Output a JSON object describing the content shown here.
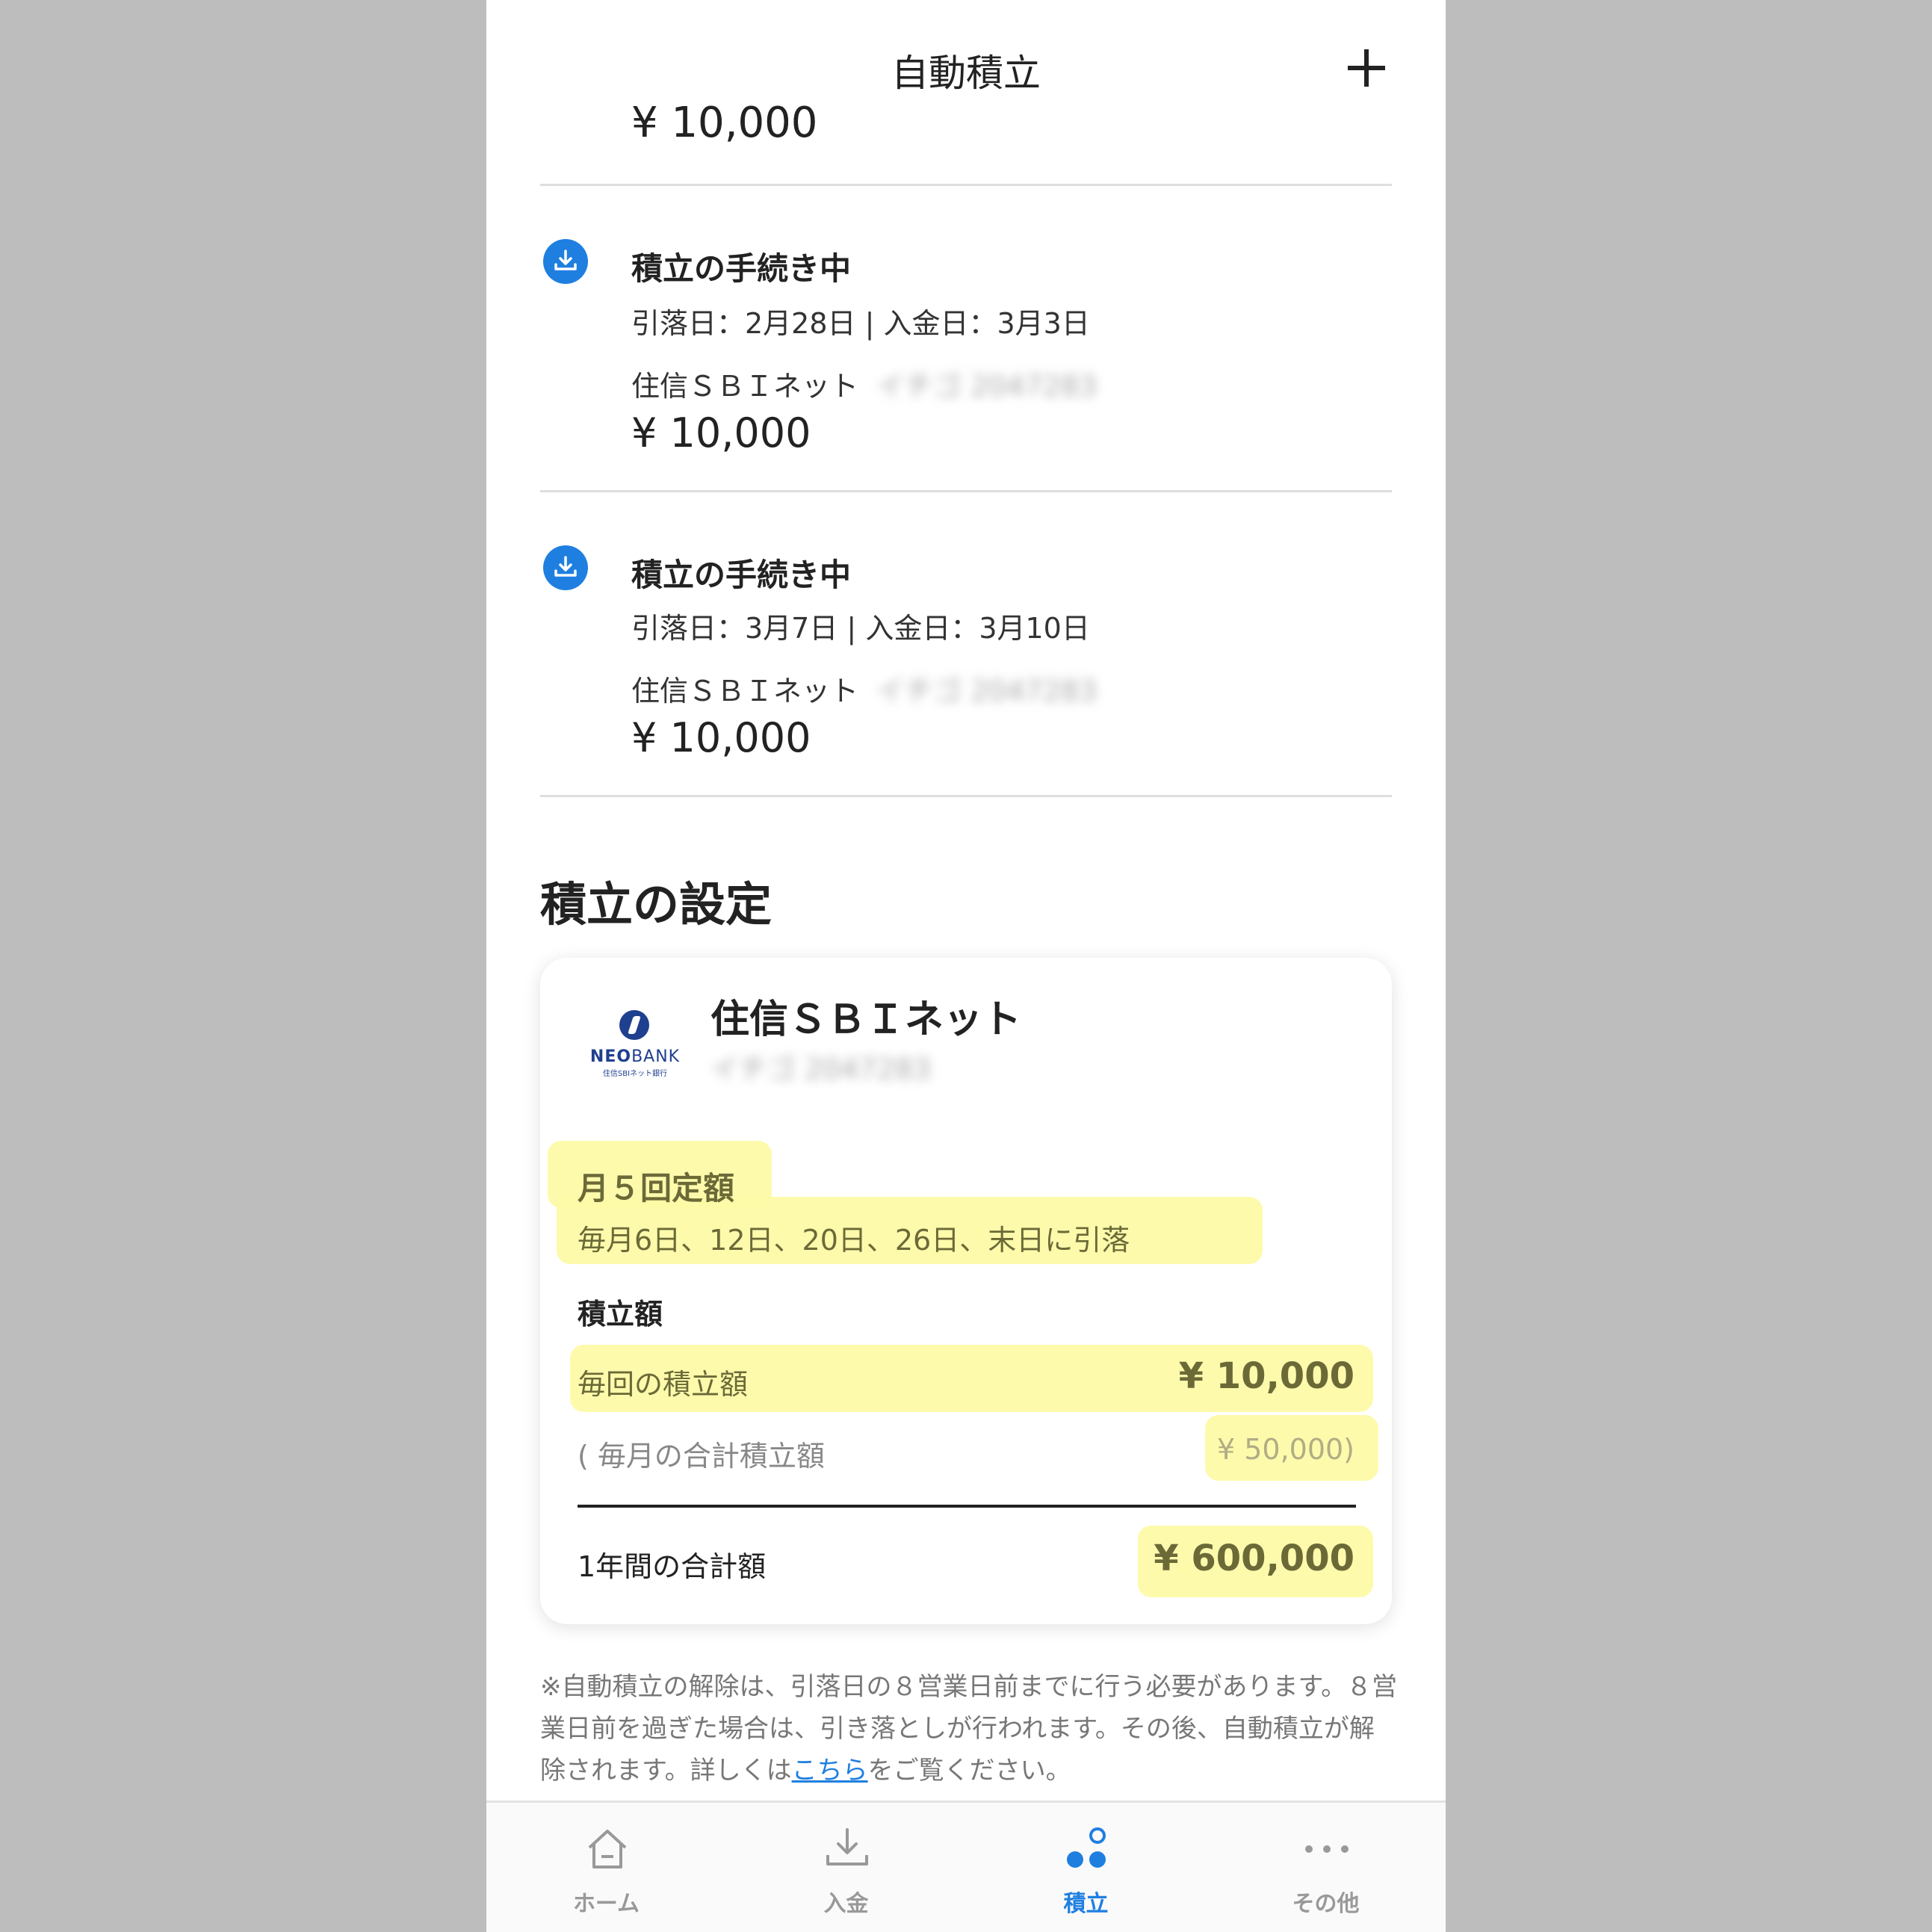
{
  "header": {
    "title": "自動積立",
    "add_label": "+"
  },
  "partial_top_amount": "¥ 10,000",
  "transfers": [
    {
      "title": "積立の手続き中",
      "dates": "引落日：2月28日 | 入金日：3月3日",
      "bank": "住信ＳＢＩネット",
      "account_masked": "イチゴ 2047283",
      "amount": "¥ 10,000"
    },
    {
      "title": "積立の手続き中",
      "dates": "引落日：3月7日 | 入金日：3月10日",
      "bank": "住信ＳＢＩネット",
      "account_masked": "イチゴ 2047283",
      "amount": "¥ 10,000"
    }
  ],
  "settings": {
    "section_title": "積立の設定",
    "bank_name": "住信ＳＢＩネット",
    "account_masked": "イチゴ 2047283",
    "logo": {
      "brand_neo": "NEO",
      "brand_bank": "BANK",
      "sub": "住信SBIネット銀行"
    },
    "plan_title": "月５回定額",
    "plan_description": "毎月6日、12日、20日、26日、末日に引落",
    "amount_label": "積立額",
    "per_time_label": "毎回の積立額",
    "per_time_value": "¥ 10,000",
    "monthly_label": "( 毎月の合計積立額",
    "monthly_value": "¥ 50,000)",
    "yearly_label": "1年間の合計額",
    "yearly_value": "¥ 600,000"
  },
  "note": {
    "text_before": "※自動積立の解除は、引落日の８営業日前までに行う必要があります。８営業日前を過ぎた場合は、引き落としが行われます。その後、自動積立が解除されます。詳しくは",
    "link": "こちら",
    "text_after": "をご覧ください。"
  },
  "tabs": [
    {
      "label": "ホーム",
      "icon": "home-icon",
      "active": false
    },
    {
      "label": "入金",
      "icon": "deposit-icon",
      "active": false
    },
    {
      "label": "積立",
      "icon": "savings-dots-icon",
      "active": true
    },
    {
      "label": "その他",
      "icon": "more-dots-icon",
      "active": false
    }
  ],
  "colors": {
    "accent_blue": "#1f7fe0",
    "highlight_yellow": "#fdfaa8",
    "highlight_text": "#6b6a37",
    "background_gray": "#bdbdbd"
  }
}
